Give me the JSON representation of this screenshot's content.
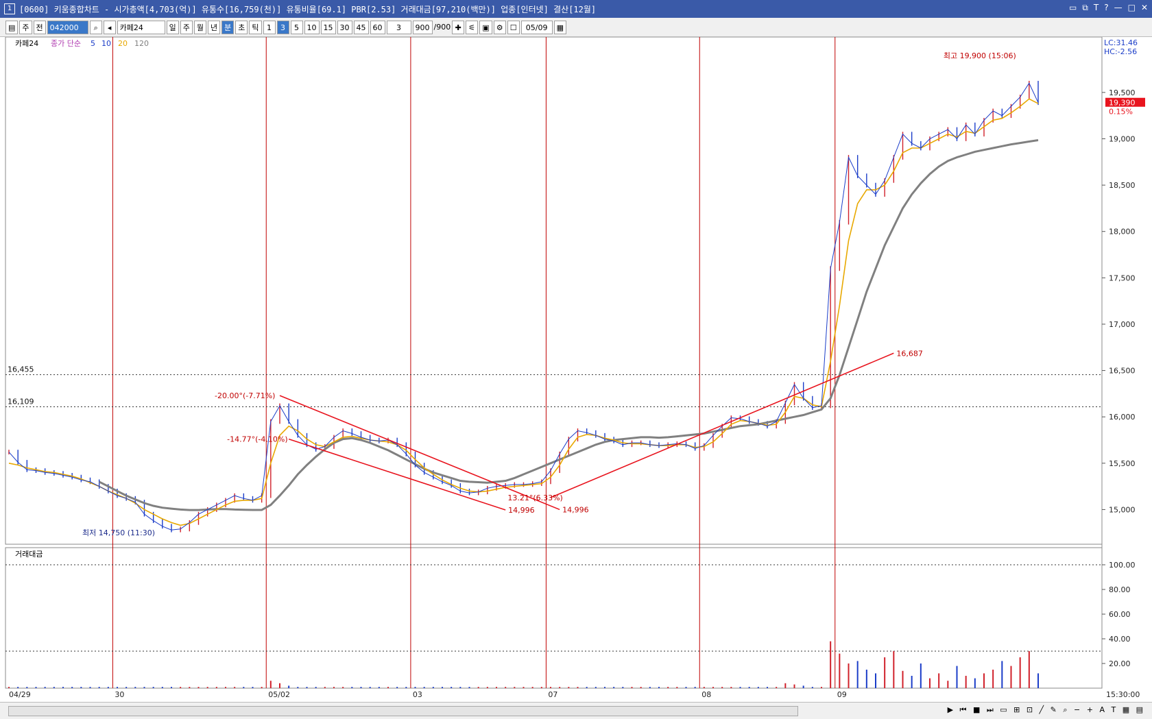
{
  "window": {
    "icon_label": "1",
    "title": "[0600] 키움종합차트 - 시가총액[4,703(억)] 유통수[16,759(천)] 유통비율[69.1] PBR[2.53] 거래대금[97,210(백만)] 업종[인터넷] 결산[12월]",
    "buttons": [
      "▭",
      "⧉",
      "T",
      "?",
      "—",
      "□",
      "✕"
    ]
  },
  "toolbar": {
    "items": [
      "주",
      "전",
      "042000",
      "카페24",
      "일",
      "주",
      "월",
      "년",
      "분",
      "초",
      "틱",
      "1",
      "3",
      "5",
      "10",
      "15",
      "30",
      "45",
      "60",
      "3",
      "900",
      "/900",
      "05/09"
    ],
    "code_value": "042000",
    "stock_name": "카페24",
    "period_buttons": [
      "일",
      "주",
      "월",
      "년",
      "분",
      "초",
      "틱"
    ],
    "selected_period": "분",
    "interval_buttons": [
      "1",
      "3",
      "5",
      "10",
      "15",
      "30",
      "45",
      "60"
    ],
    "selected_interval": "3",
    "count_value": "900",
    "count_total": "/900",
    "date_value": "05/09"
  },
  "chart_data": {
    "type": "line",
    "price_panel": {
      "legend": {
        "name": "카페24",
        "ma_type": "종가 단순",
        "ma_periods": [
          "5",
          "10",
          "20",
          "120"
        ],
        "colors": {
          "price_ma": "#b03cb0",
          "ma5": "#1a3cc8",
          "ma10": "#1a3cc8",
          "ma20": "#e8a800",
          "ma120": "#808080"
        }
      },
      "lc_label": "LC:31.46",
      "hc_label": "HC:-2.56",
      "y_ticks": [
        "19,500",
        "19,000",
        "18,500",
        "18,000",
        "17,500",
        "17,000",
        "16,500",
        "16,000",
        "15,500",
        "15,000"
      ],
      "ylim": [
        14700,
        19950
      ],
      "current_price": "19,390",
      "current_change": "0.15%",
      "hlines": [
        {
          "label": "16,455",
          "value": 16455
        },
        {
          "label": "16,109",
          "value": 16109
        }
      ],
      "annotations": {
        "high": "최고 19,900 (15:06)",
        "low": "최저 14,750 (11:30)",
        "angle1": "-20.00°(-7.71%)",
        "angle2": "-14.77°(-4.10%)",
        "angle3": "13.21°(6.33%)",
        "val1": "14,996",
        "val2": "14,996",
        "val3": "16,687"
      },
      "close_series": [
        15620,
        15510,
        15430,
        15420,
        15400,
        15390,
        15370,
        15350,
        15320,
        15300,
        15250,
        15200,
        15150,
        15120,
        15080,
        14950,
        14880,
        14820,
        14780,
        14790,
        14860,
        14950,
        15000,
        15050,
        15100,
        15150,
        15120,
        15100,
        15150,
        15950,
        16120,
        15950,
        15800,
        15700,
        15650,
        15680,
        15780,
        15850,
        15820,
        15780,
        15750,
        15740,
        15750,
        15700,
        15600,
        15480,
        15400,
        15350,
        15300,
        15260,
        15200,
        15180,
        15190,
        15230,
        15250,
        15260,
        15270,
        15270,
        15280,
        15300,
        15420,
        15600,
        15760,
        15850,
        15830,
        15800,
        15760,
        15740,
        15700,
        15720,
        15720,
        15700,
        15690,
        15700,
        15710,
        15700,
        15660,
        15690,
        15800,
        15900,
        15990,
        15980,
        15950,
        15930,
        15900,
        15950,
        16150,
        16350,
        16200,
        16100,
        16120,
        17600,
        18100,
        18800,
        18600,
        18500,
        18400,
        18550,
        18800,
        19050,
        18950,
        18900,
        19000,
        19050,
        19100,
        19000,
        19150,
        19050,
        19200,
        19300,
        19250,
        19350,
        19450,
        19600,
        19390
      ],
      "ma20_series": [
        15500,
        15480,
        15450,
        15430,
        15410,
        15400,
        15380,
        15360,
        15330,
        15290,
        15250,
        15200,
        15160,
        15120,
        15070,
        15000,
        14950,
        14900,
        14860,
        14830,
        14850,
        14900,
        14950,
        15000,
        15050,
        15090,
        15100,
        15100,
        15120,
        15500,
        15800,
        15900,
        15850,
        15760,
        15700,
        15680,
        15730,
        15780,
        15790,
        15770,
        15750,
        15740,
        15730,
        15700,
        15640,
        15540,
        15450,
        15380,
        15320,
        15270,
        15230,
        15200,
        15190,
        15200,
        15220,
        15240,
        15250,
        15260,
        15270,
        15280,
        15350,
        15480,
        15650,
        15780,
        15810,
        15800,
        15770,
        15750,
        15720,
        15710,
        15710,
        15700,
        15690,
        15690,
        15700,
        15700,
        15670,
        15680,
        15730,
        15820,
        15920,
        15960,
        15950,
        15930,
        15910,
        15920,
        16050,
        16220,
        16200,
        16130,
        16110,
        16600,
        17200,
        17900,
        18300,
        18450,
        18450,
        18500,
        18650,
        18850,
        18900,
        18900,
        18950,
        19000,
        19050,
        19020,
        19080,
        19060,
        19130,
        19200,
        19220,
        19280,
        19350,
        19430,
        19380
      ],
      "ma120_series": [
        null,
        null,
        null,
        null,
        null,
        null,
        null,
        null,
        null,
        null,
        15300,
        15250,
        15200,
        15150,
        15110,
        15070,
        15040,
        15020,
        15010,
        15000,
        14995,
        14995,
        15000,
        15005,
        15005,
        15000,
        14998,
        14996,
        14996,
        15050,
        15150,
        15260,
        15380,
        15480,
        15570,
        15650,
        15720,
        15760,
        15770,
        15750,
        15720,
        15680,
        15640,
        15590,
        15540,
        15490,
        15440,
        15400,
        15370,
        15340,
        15310,
        15300,
        15295,
        15290,
        15300,
        15310,
        15340,
        15380,
        15420,
        15460,
        15500,
        15540,
        15580,
        15620,
        15660,
        15700,
        15730,
        15750,
        15760,
        15770,
        15780,
        15780,
        15775,
        15780,
        15790,
        15800,
        15810,
        15820,
        15840,
        15860,
        15880,
        15900,
        15910,
        15920,
        15940,
        15960,
        15980,
        16000,
        16020,
        16050,
        16080,
        16200,
        16450,
        16750,
        17050,
        17350,
        17600,
        17850,
        18050,
        18250,
        18400,
        18520,
        18620,
        18700,
        18760,
        18800,
        18830,
        18860,
        18880,
        18900,
        18920,
        18940,
        18955,
        18970,
        18985
      ]
    },
    "volume_panel": {
      "label": "거래대금",
      "y_ticks": [
        "100.00",
        "80.00",
        "60.00",
        "40.00",
        "20.00"
      ],
      "ylim": [
        0,
        100
      ],
      "hlines": [
        100,
        30
      ],
      "values": [
        1,
        1,
        1,
        1,
        1,
        1,
        1,
        1,
        1,
        1,
        1,
        1,
        1,
        1,
        1,
        1,
        1,
        1,
        1,
        1,
        1,
        1,
        1,
        1,
        1,
        1,
        1,
        1,
        1,
        6,
        4,
        2,
        1,
        1,
        1,
        1,
        1,
        1,
        1,
        1,
        1,
        1,
        1,
        1,
        1,
        1,
        1,
        1,
        1,
        1,
        1,
        1,
        1,
        1,
        1,
        1,
        1,
        1,
        1,
        1,
        1,
        1,
        1,
        1,
        1,
        1,
        1,
        1,
        1,
        1,
        1,
        1,
        1,
        1,
        1,
        1,
        1,
        1,
        1,
        1,
        1,
        1,
        1,
        1,
        1,
        1,
        4,
        3,
        2,
        1,
        1,
        38,
        28,
        20,
        22,
        15,
        12,
        25,
        30,
        14,
        10,
        20,
        8,
        12,
        6,
        18,
        10,
        8,
        12,
        15,
        22,
        18,
        25,
        30,
        12
      ]
    },
    "x_ticks": [
      "04/29",
      "30",
      "05/02",
      "03",
      "07",
      "08",
      "09"
    ],
    "time_label": "15:30:00"
  },
  "statusbar": {
    "tool_icons": "▶ ⏮ ■ ⏭ ▭ ⊞ ⊡ ╱ ✎ ⌕ − + A T ▦ ▤"
  }
}
